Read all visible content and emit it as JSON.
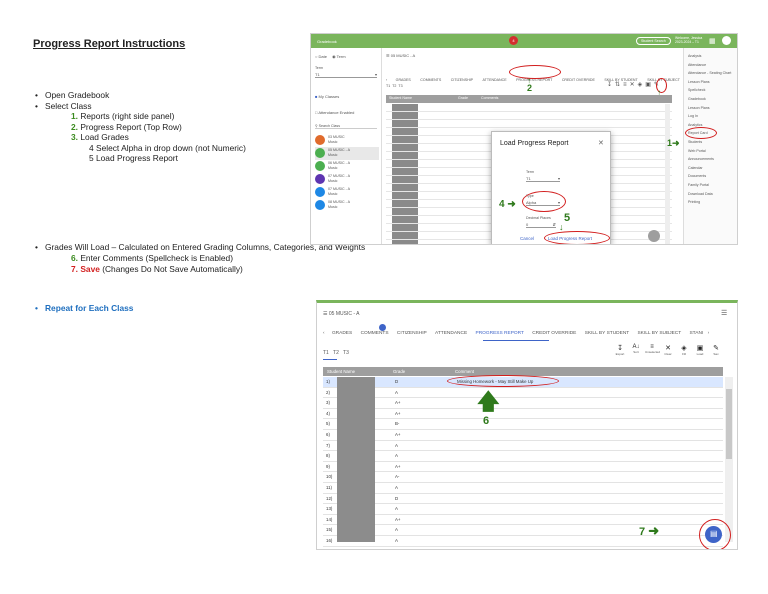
{
  "doc": {
    "title": "Progress Report Instructions",
    "steps": {
      "open": "Open Gradebook",
      "select": "Select Class",
      "s1_num": "1.",
      "s1_text": "Reports (right side panel)",
      "s2_num": "2.",
      "s2_text": "Progress Report (Top Row)",
      "s3_num": "3.",
      "s3_text": "Load Grades",
      "s4": "4 Select Alpha in drop down (not Numeric)",
      "s5": "5 Load Progress Report",
      "grades": "Grades Will Load – Calculated on Entered Grading Columns, Categories, and Weights",
      "s6_num": "6.",
      "s6_text": "Enter Comments (Spellcheck is Enabled)",
      "s7_num": "7.",
      "s7_word": "Save",
      "s7_text": "(Changes Do Not Save Automatically)",
      "repeat": "Repeat for Each Class"
    }
  },
  "top_shot": {
    "app_title": "Gradebook",
    "badge": "4",
    "header_btn": "Student Search",
    "user_line1": "Welcome, Jessica",
    "user_line2": "2023-2024 – T1",
    "radio_date": "Date",
    "radio_term": "Term",
    "term_label": "Term",
    "term_value": "T1",
    "my_classes": "My Classes",
    "attendance_enabled": "Attendance Enabled",
    "search_placeholder": "Search Class",
    "classes": [
      {
        "name": "03 MUSIC",
        "sub": "Music",
        "color": "#e06b2c"
      },
      {
        "name": "05 MUSIC - A",
        "sub": "Music",
        "color": "#4caf50"
      },
      {
        "name": "06 MUSIC - A",
        "sub": "Music",
        "color": "#4caf50"
      },
      {
        "name": "07 MUSIC - A",
        "sub": "Music",
        "color": "#5e35b1"
      },
      {
        "name": "07 MUSIC - A",
        "sub": "Music",
        "color": "#1e88e5"
      },
      {
        "name": "08 MUSIC - A",
        "sub": "Music",
        "color": "#1e88e5"
      }
    ],
    "class_header": "05 MUSIC - A",
    "tabs": [
      "GRADES",
      "COMMENTS",
      "CITIZENSHIP",
      "ATTENDANCE",
      "PROGRESS REPORT",
      "CREDIT OVERRIDE",
      "SKILL BY STUDENT",
      "SKILL BY SUBJECT",
      "STANI"
    ],
    "terms": [
      "T1",
      "T2",
      "T3"
    ],
    "col_student": "Student Name",
    "col_grade": "Grade",
    "col_comment": "Comments",
    "right_panel": [
      "Analysis",
      "Attendance",
      "Attendance - Seating Chart",
      "Lesson Plans",
      "Spellcheck",
      "Gradebook",
      "Lesson Plans",
      "Log In",
      "Analytics",
      "Report Card",
      "Students",
      "Web Portal",
      "Announcements",
      "Calendar",
      "Documents",
      "Family Portal",
      "Download Data",
      "Printing"
    ],
    "right_selected": "Report Card",
    "dialog": {
      "title": "Load Progress Report",
      "term_label": "Term",
      "term_value": "T1",
      "type_label": "Type",
      "type_value": "Alpha",
      "decimal_label": "Decimal Places",
      "decimal_value": "0",
      "cancel": "Cancel",
      "load": "Load Progress Report"
    },
    "callouts": {
      "c1": "1",
      "c2": "2",
      "c3": "3",
      "c4": "4",
      "c5": "5"
    }
  },
  "bottom_shot": {
    "class_header": "05 MUSIC - A",
    "tabs": [
      "GRADES",
      "COMMENTS",
      "CITIZENSHIP",
      "ATTENDANCE",
      "PROGRESS REPORT",
      "CREDIT OVERRIDE",
      "SKILL BY STUDENT",
      "SKILL BY SUBJECT",
      "STANI"
    ],
    "terms": [
      "T1",
      "T2",
      "T3"
    ],
    "tools": [
      "Export",
      "Sort",
      "Unselected",
      "Clear",
      "Fill",
      "Load",
      "Sav"
    ],
    "col_student": "Student Name",
    "col_grade": "Grade",
    "col_comment": "Comment",
    "rows": [
      {
        "n": "1)",
        "grade": "D",
        "comment": "Missing Homework - May Still Make Up"
      },
      {
        "n": "2)",
        "grade": "A",
        "comment": ""
      },
      {
        "n": "3)",
        "grade": "A+",
        "comment": ""
      },
      {
        "n": "4)",
        "grade": "A+",
        "comment": ""
      },
      {
        "n": "5)",
        "grade": "B-",
        "comment": ""
      },
      {
        "n": "6)",
        "grade": "A+",
        "comment": ""
      },
      {
        "n": "7)",
        "grade": "A",
        "comment": ""
      },
      {
        "n": "8)",
        "grade": "A",
        "comment": ""
      },
      {
        "n": "9)",
        "grade": "A+",
        "comment": ""
      },
      {
        "n": "10)",
        "grade": "A-",
        "comment": ""
      },
      {
        "n": "11)",
        "grade": "A",
        "comment": ""
      },
      {
        "n": "12)",
        "grade": "D",
        "comment": ""
      },
      {
        "n": "13)",
        "grade": "A",
        "comment": ""
      },
      {
        "n": "14)",
        "grade": "A+",
        "comment": ""
      },
      {
        "n": "15)",
        "grade": "A",
        "comment": ""
      },
      {
        "n": "16)",
        "grade": "A",
        "comment": ""
      },
      {
        "n": "17)",
        "grade": "B",
        "comment": ""
      }
    ],
    "callouts": {
      "c6": "6",
      "c7": "7"
    }
  }
}
